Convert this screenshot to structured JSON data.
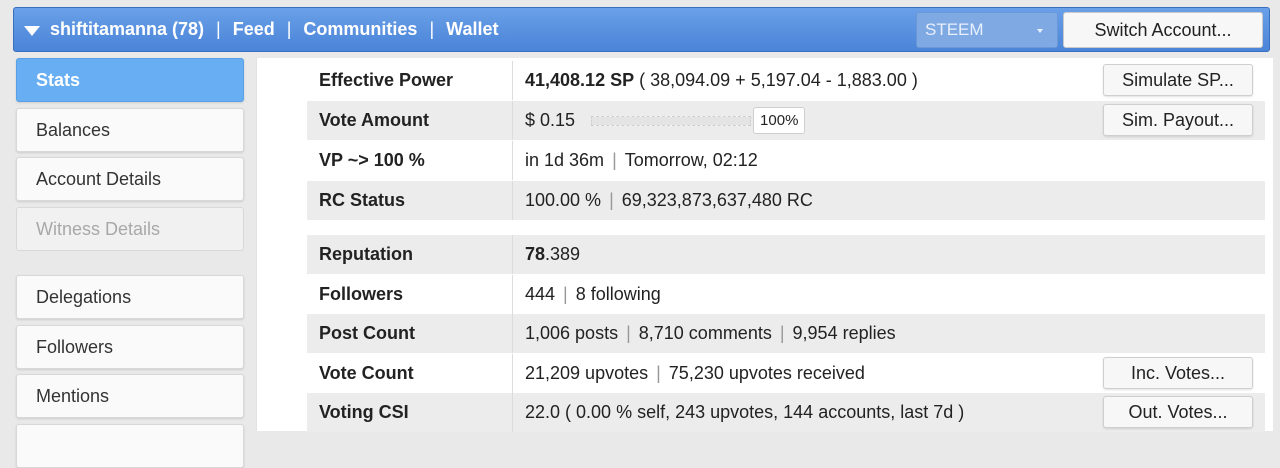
{
  "nav": {
    "username": "shiftitamanna (78)",
    "links": [
      "Feed",
      "Communities",
      "Wallet"
    ],
    "chain_select": "STEEM",
    "switch_label": "Switch Account..."
  },
  "sidebar": {
    "items": [
      {
        "label": "Stats",
        "state": "active"
      },
      {
        "label": "Balances",
        "state": "normal"
      },
      {
        "label": "Account Details",
        "state": "normal"
      },
      {
        "label": "Witness Details",
        "state": "disabled"
      },
      {
        "label": "Delegations",
        "state": "normal"
      },
      {
        "label": "Followers",
        "state": "normal"
      },
      {
        "label": "Mentions",
        "state": "normal"
      }
    ]
  },
  "stats": {
    "effective_power": {
      "label": "Effective Power",
      "value": "41,408.12 SP",
      "detail": "( 38,094.09 + 5,197.04 - 1,883.00 )",
      "button": "Simulate SP..."
    },
    "vote_amount": {
      "label": "Vote Amount",
      "value": "$ 0.15",
      "slider_percent": 100,
      "percent_label": "100%",
      "button": "Sim. Payout..."
    },
    "vp": {
      "label": "VP ~> 100 %",
      "time": "in 1d 36m",
      "when": "Tomorrow, 02:12"
    },
    "rc": {
      "label": "RC Status",
      "percent": "100.00 %",
      "amount": "69,323,873,637,480 RC"
    },
    "reputation": {
      "label": "Reputation",
      "int": "78",
      "frac": ".389"
    },
    "followers": {
      "label": "Followers",
      "count": "444",
      "following": "8 following"
    },
    "post_count": {
      "label": "Post Count",
      "posts": "1,006 posts",
      "comments": "8,710 comments",
      "replies": "9,954 replies"
    },
    "vote_count": {
      "label": "Vote Count",
      "upvotes": "21,209 upvotes",
      "received": "75,230 upvotes received",
      "button": "Inc. Votes..."
    },
    "voting_csi": {
      "label": "Voting CSI",
      "value": "22.0 ( 0.00 % self, 243 upvotes, 144 accounts, last 7d )",
      "button": "Out. Votes..."
    }
  },
  "colors": {
    "nav_blue": "#4a84d8",
    "active_tab": "#67aef2"
  }
}
